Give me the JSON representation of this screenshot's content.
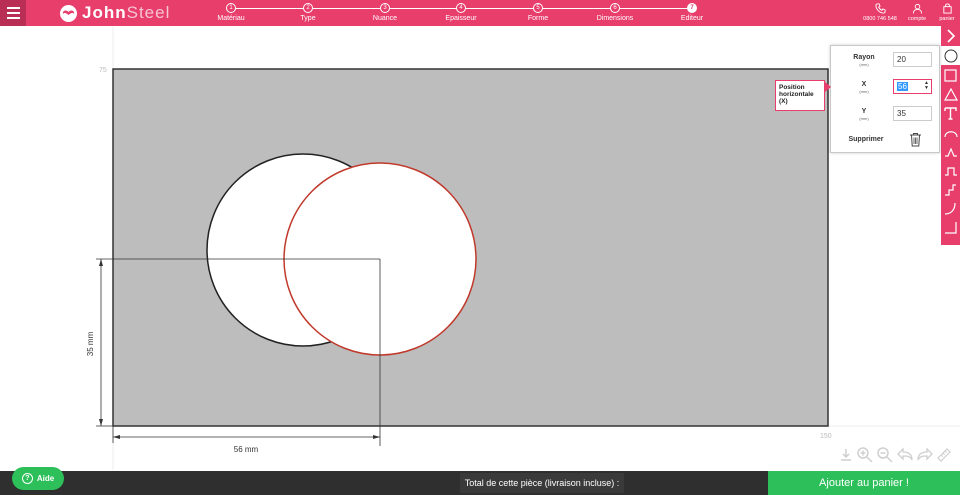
{
  "header": {
    "brand_prefix": "John",
    "brand_suffix": "Steel",
    "steps": [
      {
        "num": "1",
        "label": "Matériau",
        "active": false
      },
      {
        "num": "2",
        "label": "Type",
        "active": false
      },
      {
        "num": "3",
        "label": "Nuance",
        "active": false
      },
      {
        "num": "4",
        "label": "Epaisseur",
        "active": false
      },
      {
        "num": "5",
        "label": "Forme",
        "active": false
      },
      {
        "num": "6",
        "label": "Dimensions",
        "active": false
      },
      {
        "num": "7",
        "label": "Editeur",
        "active": true
      }
    ],
    "phone": "0800 746 548",
    "account": "compte",
    "cart": "panier"
  },
  "editor": {
    "plate_color": "#bdbdbd",
    "circle_black_color": "#222222",
    "circle_red_color": "#c0392b",
    "axis_top_label": "75",
    "axis_right_label": "150",
    "dim_vertical": "35 mm",
    "dim_horizontal": "56 mm"
  },
  "shape_panel": {
    "rayon_label": "Rayon",
    "rayon_unit": "(mm)",
    "rayon_value": "20",
    "x_label": "X",
    "x_unit": "(mm)",
    "x_value": "56",
    "y_label": "Y",
    "y_unit": "(mm)",
    "y_value": "35",
    "delete_label": "Supprimer"
  },
  "tooltip": {
    "text_line1": "Position",
    "text_line2": "horizontale",
    "text_line3": "(X)"
  },
  "toolbar": {
    "tools": [
      "chevron-right-icon",
      "circle-tool-icon",
      "square-tool-icon",
      "triangle-tool-icon",
      "text-tool-icon",
      "arc-tool-icon",
      "chamfer-tool-icon",
      "notch-tool-icon",
      "step-tool-icon",
      "curve-tool-icon",
      "corner-tool-icon"
    ]
  },
  "footer": {
    "help_label": "Aide",
    "total_label": "Total de cette pièce (livraison incluse) :",
    "add_cart_label": "Ajouter au panier !"
  },
  "colors": {
    "accent": "#e83e6c",
    "green": "#2dbf5a",
    "dark": "#2f2f2f"
  }
}
